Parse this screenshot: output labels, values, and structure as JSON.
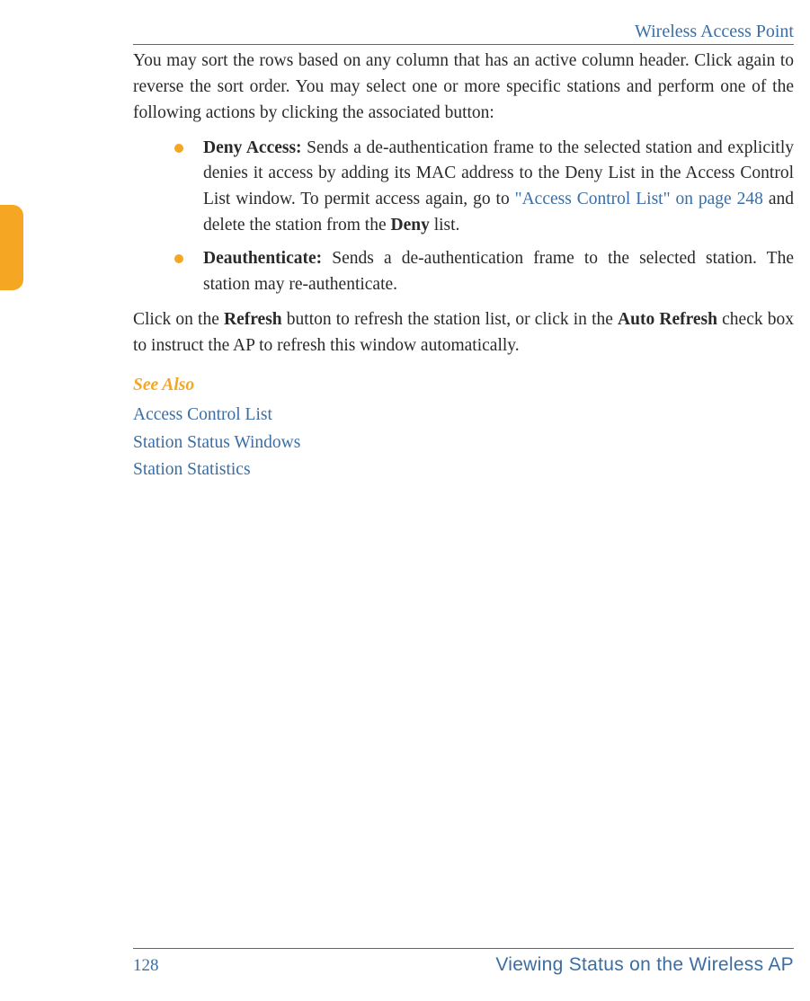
{
  "header": {
    "title": "Wireless Access Point"
  },
  "body": {
    "intro": "You may sort the rows based on any column that has an active column header. Click again to reverse the sort order. You may select one or more specific stations and perform one of the following actions by clicking the associated button:",
    "bullets": [
      {
        "label": "Deny Access:",
        "text_before_link": " Sends a de-authentication frame to the selected station and explicitly denies it access by adding its MAC address to the Deny List in the Access Control List window. To permit access again, go to ",
        "link": "\"Access Control List\" on page 248",
        "text_after_link": " and delete the station from the ",
        "bold_tail": "Deny",
        "tail": " list."
      },
      {
        "label": "Deauthenticate:",
        "text": " Sends a de-authentication frame to the selected station. The station may re-authenticate."
      }
    ],
    "closing_before_b1": "Click on the ",
    "closing_b1": "Refresh",
    "closing_mid": " button to refresh the station list, or click in the ",
    "closing_b2": "Auto Refresh",
    "closing_after": " check box to instruct the AP to refresh this window automatically.",
    "see_also_heading": "See Also",
    "see_also_links": [
      "Access Control List",
      "Station Status Windows",
      "Station Statistics"
    ]
  },
  "footer": {
    "page": "128",
    "section": "Viewing Status on the Wireless AP"
  }
}
